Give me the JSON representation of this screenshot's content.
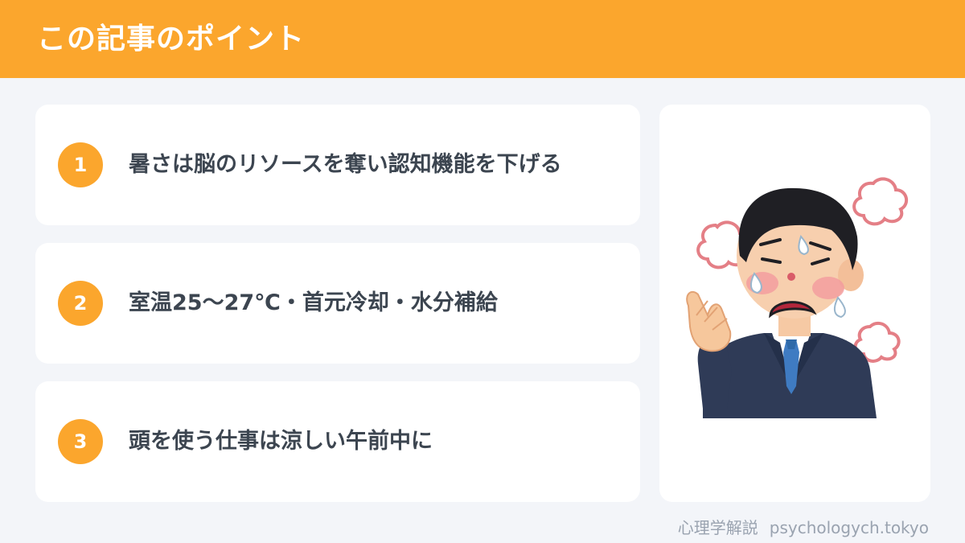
{
  "header": {
    "title": "この記事のポイント"
  },
  "points": [
    {
      "number": "1",
      "text": "暑さは脳のリソースを奪い認知機能を下げる"
    },
    {
      "number": "2",
      "text": "室温25〜27℃・首元冷却・水分補給"
    },
    {
      "number": "3",
      "text": "頭を使う仕事は涼しい午前中に"
    }
  ],
  "illustration": {
    "icon": "hot-exhausted-businessman-icon"
  },
  "footer": {
    "site_name": "心理学解説",
    "domain": "psychologych.tokyo"
  },
  "colors": {
    "accent": "#fba62d",
    "background": "#f3f5f9",
    "text": "#3c4550",
    "muted": "#9aa3b0"
  }
}
